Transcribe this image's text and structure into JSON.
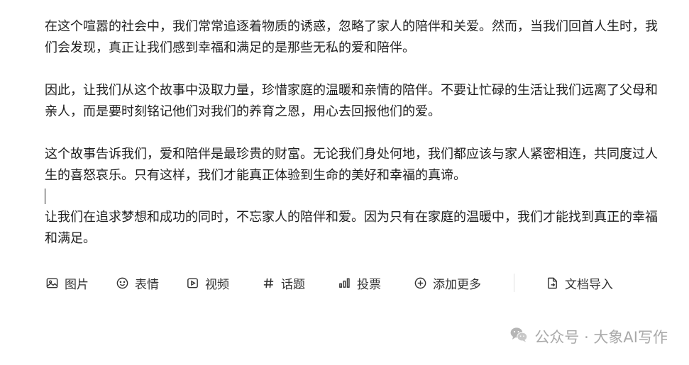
{
  "editor": {
    "paragraphs": [
      "在这个喧嚣的社会中，我们常常追逐着物质的诱惑，忽略了家人的陪伴和关爱。然而，当我们回首人生时，我们会发现，真正让我们感到幸福和满足的是那些无私的爱和陪伴。",
      "因此，让我们从这个故事中汲取力量，珍惜家庭的温暖和亲情的陪伴。不要让忙碌的生活让我们远离了父母和亲人，而是要时刻铭记他们对我们的养育之恩，用心去回报他们的爱。",
      "这个故事告诉我们，爱和陪伴是最珍贵的财富。无论我们身处何地，我们都应该与家人紧密相连，共同度过人生的喜怒哀乐。只有这样，我们才能真正体验到生命的美好和幸福的真谛。",
      "让我们在追求梦想和成功的同时，不忘家人的陪伴和爱。因为只有在家庭的温暖中，我们才能找到真正的幸福和满足。"
    ]
  },
  "toolbar": {
    "image_label": "图片",
    "emoji_label": "表情",
    "video_label": "视频",
    "topic_label": "话题",
    "vote_label": "投票",
    "more_label": "添加更多",
    "import_label": "文档导入",
    "icons": [
      "image-icon",
      "smiley-icon",
      "video-icon",
      "hashtag-icon",
      "bar-chart-icon",
      "plus-circle-icon",
      "document-import-icon"
    ]
  },
  "watermark": {
    "text": "公众号 · 大象AI写作",
    "icon": "wechat-icon"
  },
  "colors": {
    "text": "#1f1f1f",
    "toolbar_text": "#333333",
    "watermark": "#a9a9a9"
  }
}
